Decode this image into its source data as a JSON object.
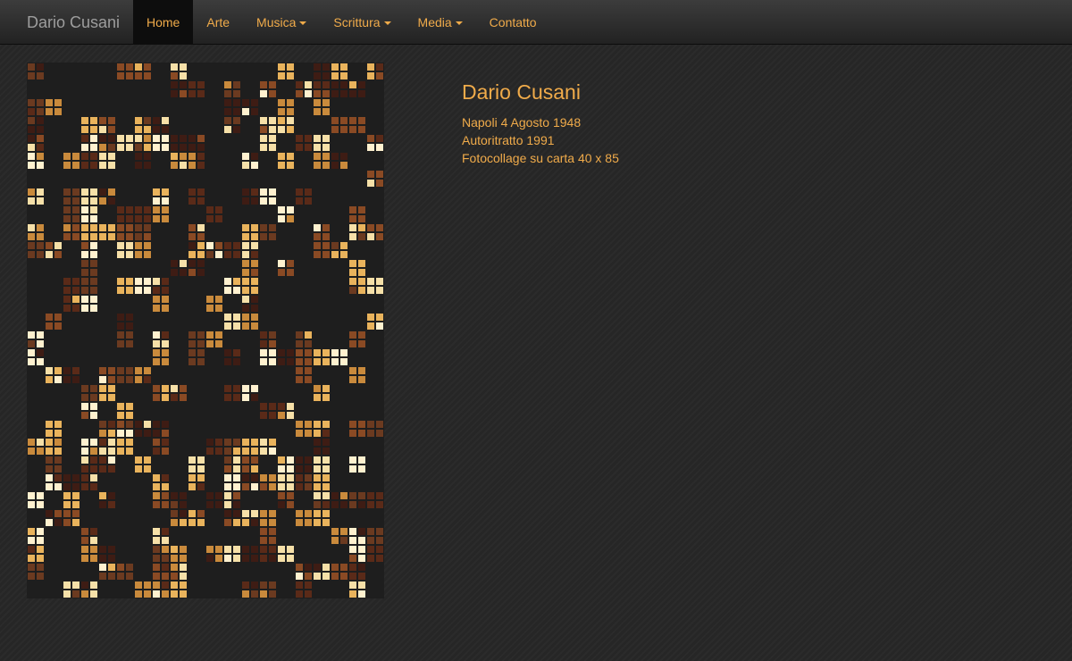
{
  "navbar": {
    "brand": "Dario Cusani",
    "items": [
      {
        "label": "Home",
        "active": true,
        "dropdown": false
      },
      {
        "label": "Arte",
        "active": false,
        "dropdown": false
      },
      {
        "label": "Musica",
        "active": false,
        "dropdown": true
      },
      {
        "label": "Scrittura",
        "active": false,
        "dropdown": true
      },
      {
        "label": "Media",
        "active": false,
        "dropdown": true
      },
      {
        "label": "Contatto",
        "active": false,
        "dropdown": false
      }
    ]
  },
  "main": {
    "title": "Dario Cusani",
    "lines": [
      "Napoli 4 Agosto 1948",
      "Autoritratto 1991",
      "Fotocollage su carta 40 x 85"
    ]
  },
  "colors": {
    "accent": "#f0ab4a",
    "brand_text": "#9d9d9d",
    "background": "#262626",
    "navbar_active": "#0d0d0d"
  }
}
